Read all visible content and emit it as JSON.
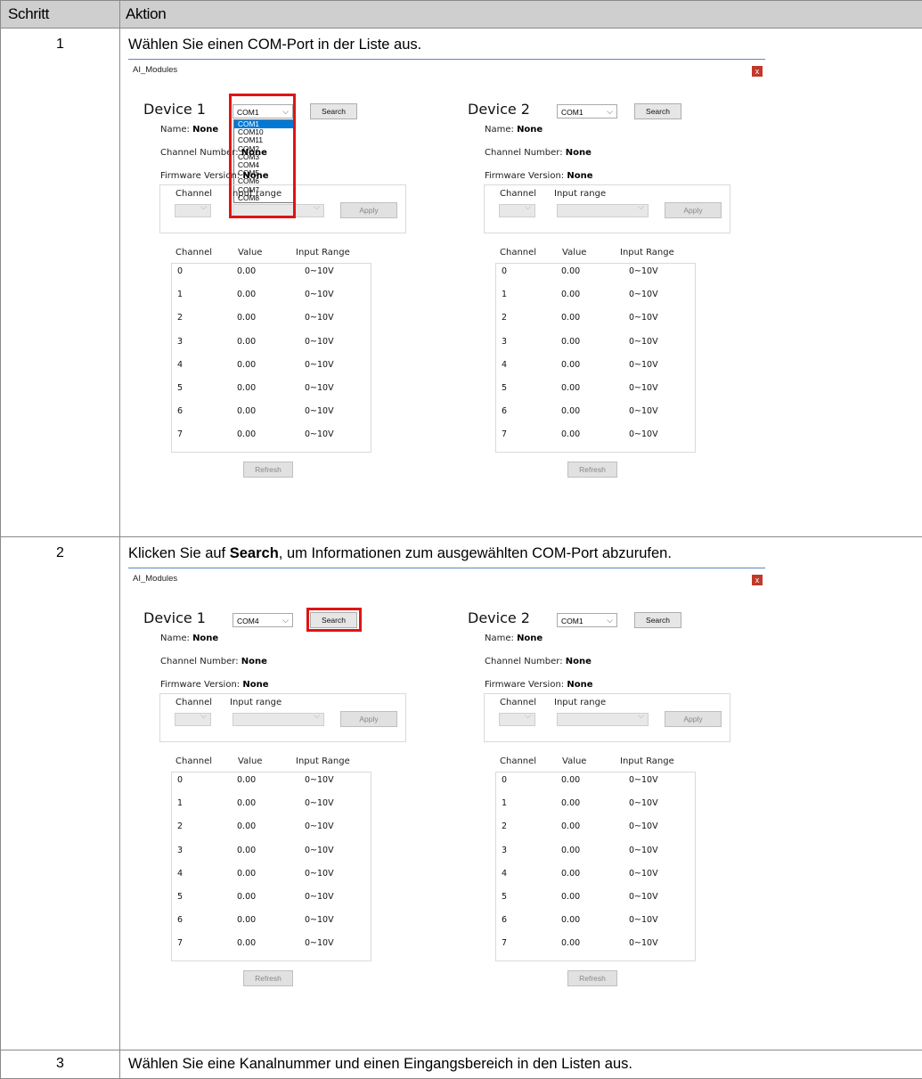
{
  "table": {
    "headers": [
      "Schritt",
      "Aktion"
    ],
    "rows": [
      {
        "step": "1",
        "text": "Wählen Sie einen COM-Port in der Liste aus."
      },
      {
        "step": "2",
        "text_before": "Klicken Sie auf ",
        "text_bold": "Search",
        "text_after": ", um Informationen zum ausgewählten COM-Port abzurufen."
      },
      {
        "step": "3",
        "text": "Wählen Sie eine Kanalnummer und einen Eingangsbereich in den Listen aus."
      }
    ]
  },
  "app": {
    "window_title": "AI_Modules",
    "close_label": "x",
    "device1": {
      "title": "Device 1"
    },
    "device2": {
      "title": "Device 2"
    },
    "search_label": "Search",
    "apply_label": "Apply",
    "refresh_label": "Refresh",
    "name_label": "Name:",
    "channel_number_label": "Channel Number:",
    "firmware_label": "Firmware Version:",
    "none_value": "None",
    "channel_label": "Channel",
    "input_range_label": "Input range",
    "col_channel": "Channel",
    "col_value": "Value",
    "col_input_range": "Input Range",
    "rows": [
      {
        "ch": "0",
        "value": "0.00",
        "range": "0~10V"
      },
      {
        "ch": "1",
        "value": "0.00",
        "range": "0~10V"
      },
      {
        "ch": "2",
        "value": "0.00",
        "range": "0~10V"
      },
      {
        "ch": "3",
        "value": "0.00",
        "range": "0~10V"
      },
      {
        "ch": "4",
        "value": "0.00",
        "range": "0~10V"
      },
      {
        "ch": "5",
        "value": "0.00",
        "range": "0~10V"
      },
      {
        "ch": "6",
        "value": "0.00",
        "range": "0~10V"
      },
      {
        "ch": "7",
        "value": "0.00",
        "range": "0~10V"
      }
    ],
    "com_options": [
      "COM1",
      "COM10",
      "COM11",
      "COM2",
      "COM3",
      "COM4",
      "COM5",
      "COM6",
      "COM7",
      "COM8"
    ],
    "screen1": {
      "device1_com": "COM1",
      "device2_com": "COM1"
    },
    "screen2": {
      "device1_com": "COM4",
      "device2_com": "COM1"
    },
    "accent_red": "#e01414"
  }
}
